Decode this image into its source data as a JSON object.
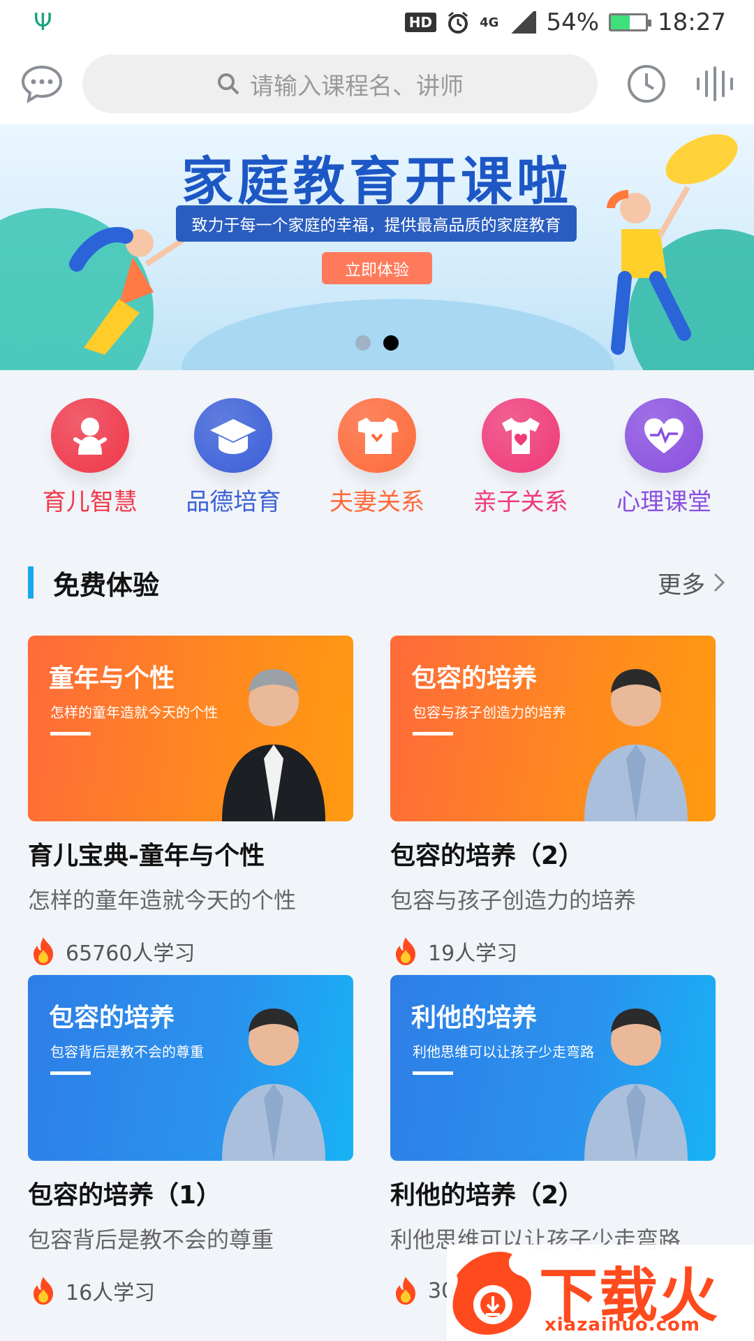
{
  "status_bar": {
    "hd_label": "HD",
    "network": "4G",
    "battery": "54%",
    "battery_level": 0.54,
    "time": "18:27"
  },
  "top_bar": {
    "search_placeholder": "请输入课程名、讲师"
  },
  "banner": {
    "title": "家庭教育开课啦",
    "subtitle": "致力于每一个家庭的幸福，提供最高品质的家庭教育",
    "cta": "立即体验",
    "active_slide": 2,
    "slide_count": 2
  },
  "categories": [
    {
      "label": "育儿智慧",
      "color": "#f0384a",
      "icon": "baby-icon"
    },
    {
      "label": "品德培育",
      "color": "#3b5fd8",
      "icon": "graduation-cap-icon"
    },
    {
      "label": "夫妻关系",
      "color": "#ff6a3a",
      "icon": "couple-shirt-icon"
    },
    {
      "label": "亲子关系",
      "color": "#f03a78",
      "icon": "tshirt-heart-icon"
    },
    {
      "label": "心理课堂",
      "color": "#8a4fe0",
      "icon": "heart-pulse-icon"
    }
  ],
  "section": {
    "title": "免费体验",
    "more": "更多"
  },
  "courses": [
    {
      "thumb_title": "童年与个性",
      "thumb_sub": "怎样的童年造就今天的个性",
      "title": "育儿宝典-童年与个性",
      "desc": "怎样的童年造就今天的个性",
      "learners": "65760人学习",
      "theme": "orange"
    },
    {
      "thumb_title": "包容的培养",
      "thumb_sub": "包容与孩子创造力的培养",
      "title": "包容的培养（2）",
      "desc": "包容与孩子创造力的培养",
      "learners": "19人学习",
      "theme": "orange"
    },
    {
      "thumb_title": "包容的培养",
      "thumb_sub": "包容背后是教不会的尊重",
      "title": "包容的培养（1）",
      "desc": "包容背后是教不会的尊重",
      "learners": "16人学习",
      "theme": "blue"
    },
    {
      "thumb_title": "利他的培养",
      "thumb_sub": "利他思维可以让孩子少走弯路",
      "title": "利他的培养（2）",
      "desc": "利他思维可以让孩子少走弯路",
      "learners": "30",
      "theme": "blue"
    }
  ],
  "watermark": {
    "name": "下载火",
    "url": "xiazaihuo.com"
  }
}
